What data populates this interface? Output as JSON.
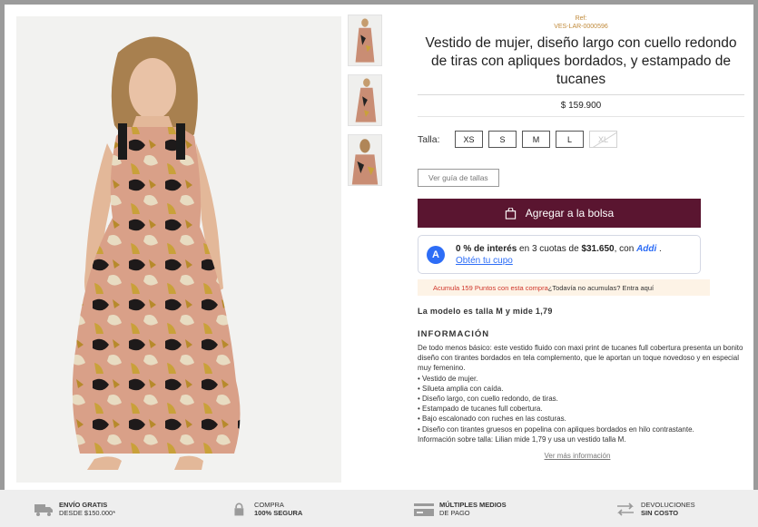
{
  "product": {
    "ref_label": "Ref:",
    "ref_code": "VES-LAR-0000596",
    "title": "Vestido de mujer, diseño largo con cuello redondo de tiras con apliques bordados, y estampado de tucanes",
    "price": "$ 159.900"
  },
  "sizes": {
    "label": "Talla:",
    "options": [
      {
        "label": "XS",
        "available": true
      },
      {
        "label": "S",
        "available": true
      },
      {
        "label": "M",
        "available": true
      },
      {
        "label": "L",
        "available": true
      },
      {
        "label": "XL",
        "available": false
      }
    ]
  },
  "buttons": {
    "size_guide": "Ver guía de tallas",
    "add_to_bag": "Agregar a la bolsa"
  },
  "financing": {
    "interest": "0 % de interés",
    "text_middle": " en 3 cuotas de ",
    "amount": "$31.650",
    "text_with": ", con ",
    "brand": "Addi",
    "period": " .",
    "link": "Obtén tu cupo",
    "logo_letter": "A"
  },
  "points": {
    "accent": "Acumula 159 Puntos con esta compra",
    "rest": " ¿Todavía no acumulas? Entra aquí"
  },
  "model_note": "La modelo es talla M y mide 1,79",
  "information": {
    "heading": "INFORMACIÓN",
    "description": "De todo menos básico: este vestido fluido con maxi print de tucanes full cobertura presenta un bonito diseño con tirantes bordados en tela complemento, que le aportan un toque novedoso y en especial muy femenino.",
    "bullets": [
      "• Vestido de mujer.",
      "• Silueta amplia con caída.",
      "• Diseño largo, con cuello redondo, de tiras.",
      "• Estampado de tucanes full cobertura.",
      "• Bajo escalonado con ruches en las costuras.",
      "• Diseño con tirantes gruesos en popelina con apliques bordados en hilo contrastante."
    ],
    "size_info": "Información sobre talla: Lilian mide 1,79 y usa un vestido talla M.",
    "more_link": "Ver más información"
  },
  "footer": {
    "shipping": {
      "line1": "ENVÍO GRATIS",
      "line2": "DESDE $150.000*",
      "icon": "truck-icon"
    },
    "secure": {
      "line1": "COMPRA",
      "line2": "100% SEGURA",
      "icon": "lock-icon"
    },
    "payment": {
      "line1": "MÚLTIPLES MEDIOS",
      "line2": "DE PAGO",
      "icon": "card-icon"
    },
    "returns": {
      "line1": "DEVOLUCIONES",
      "line2": "SIN COSTO",
      "icon": "exchange-arrows-icon"
    }
  },
  "colors": {
    "primary_button": "#5a1530",
    "addi_blue": "#2d6df6",
    "points_accent": "#d0362b",
    "ref_gold": "#c08a3a"
  }
}
